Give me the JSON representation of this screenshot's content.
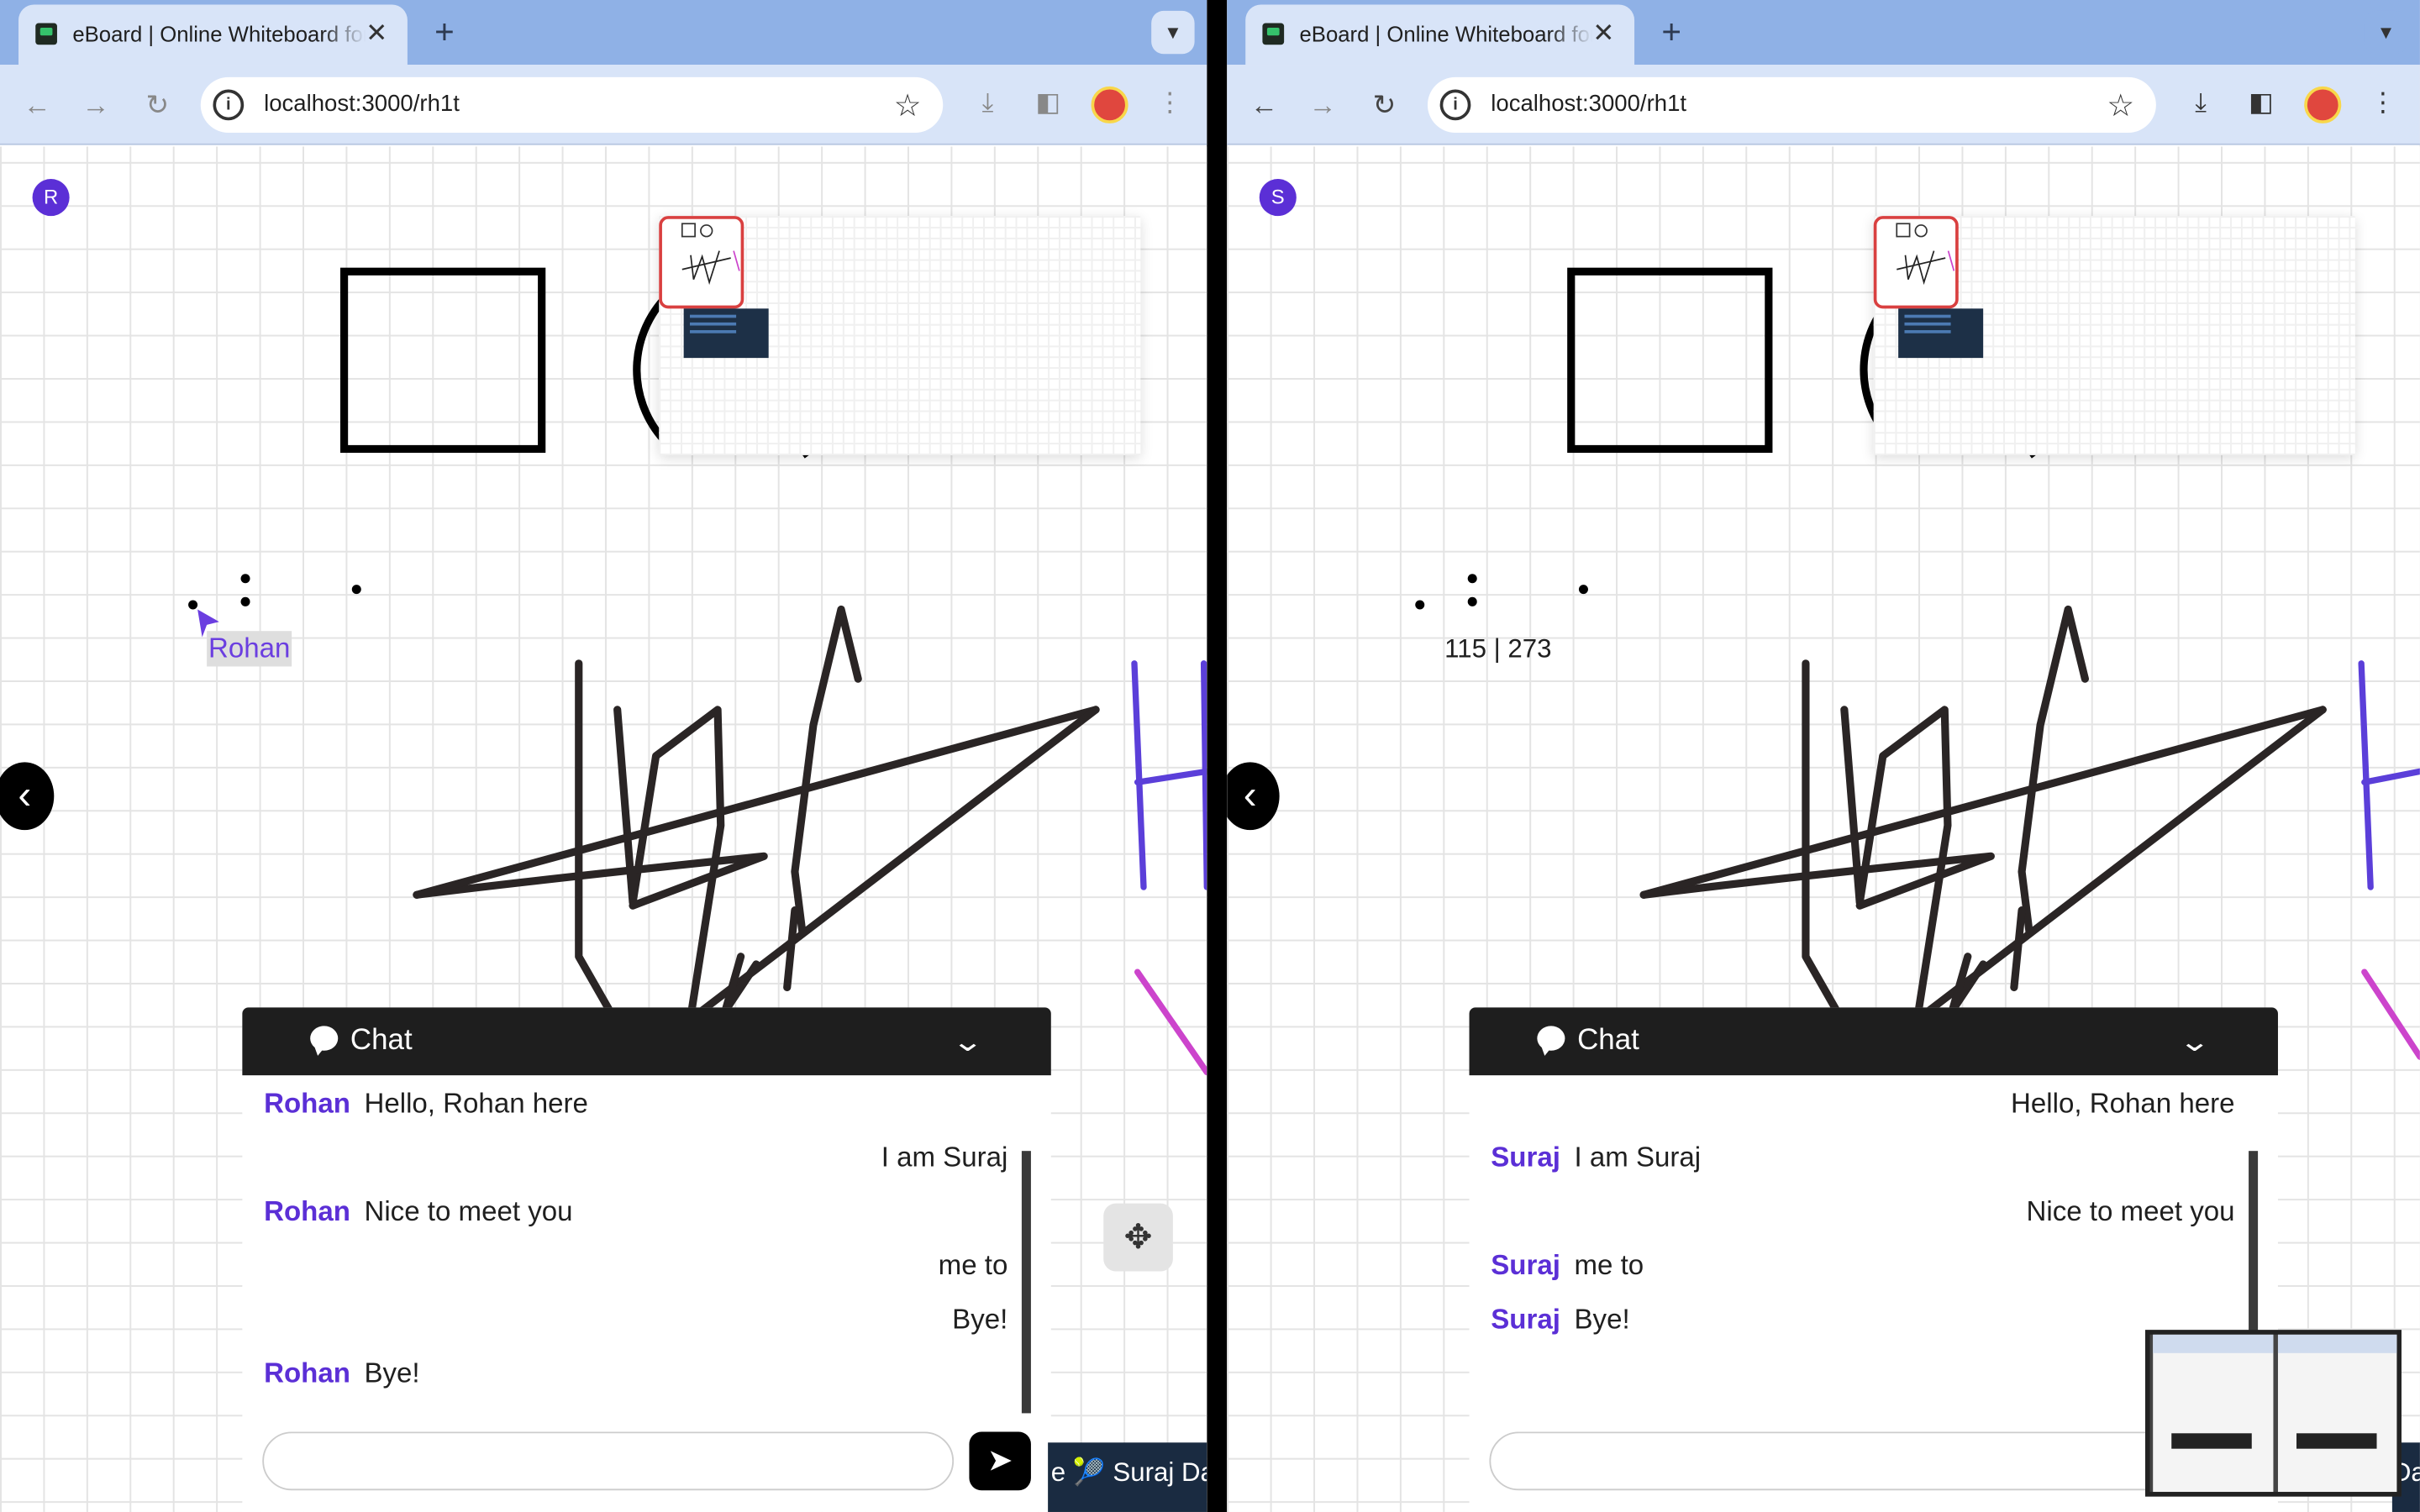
{
  "left_window": {
    "tab_title": "eBoard | Online Whiteboard for",
    "url": "localhost:3000/rh1t",
    "user_initial": "R",
    "cursor_label": "Rohan",
    "chat": {
      "title": "Chat",
      "messages": [
        {
          "author": "Rohan",
          "text": "Hello, Rohan here"
        },
        {
          "author": "",
          "text": "I am Suraj"
        },
        {
          "author": "Rohan",
          "text": "Nice to meet you"
        },
        {
          "author": "",
          "text": "me to"
        },
        {
          "author": "",
          "text": "Bye!"
        },
        {
          "author": "Rohan",
          "text": "Bye!"
        }
      ],
      "input_placeholder": ""
    },
    "user_strip": "e 🎾 Suraj Dalvi"
  },
  "right_window": {
    "tab_title": "eBoard | Online Whiteboard for",
    "url": "localhost:3000/rh1t",
    "user_initial": "S",
    "coords": "115 | 273",
    "chat": {
      "title": "Chat",
      "messages": [
        {
          "author": "",
          "text": "Hello, Rohan here"
        },
        {
          "author": "Suraj",
          "text": "I am Suraj"
        },
        {
          "author": "",
          "text": "Nice to meet you"
        },
        {
          "author": "Suraj",
          "text": "me to"
        },
        {
          "author": "Suraj",
          "text": "Bye!"
        }
      ],
      "input_placeholder": ""
    },
    "user_strip": "Da"
  },
  "icons": {
    "back": "back-arrow-icon",
    "forward": "forward-arrow-icon",
    "reload": "reload-icon",
    "bookmark": "star-icon",
    "download": "download-icon",
    "sidepanel": "side-panel-icon",
    "menu": "kebab-menu-icon",
    "chat": "chat-bubble-icon",
    "collapse": "chevron-down-icon",
    "send": "send-icon",
    "move": "move-arrows-icon",
    "sidebar_toggle": "chevron-left-icon"
  },
  "colors": {
    "accent": "#5b2fd6",
    "chat_header": "#1e1e1e",
    "tab_bar": "#8fb1e6",
    "toolbar": "#d8e4f8",
    "stroke_purple": "#5b3fd9",
    "stroke_magenta": "#cc44cc",
    "stroke_dark": "#2a2525"
  }
}
